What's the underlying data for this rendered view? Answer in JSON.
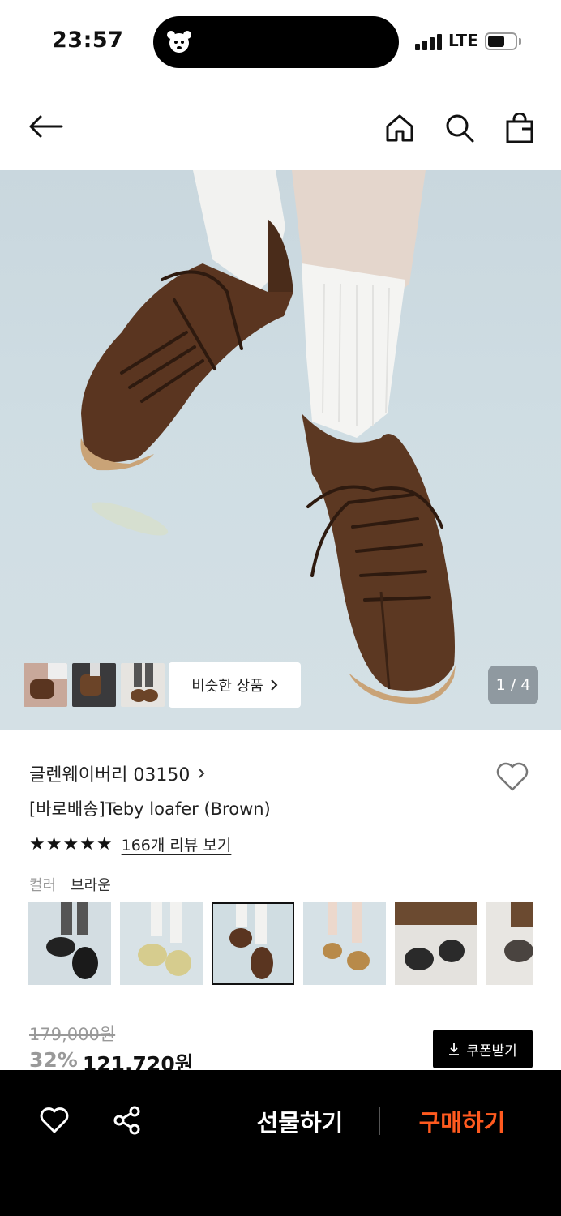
{
  "status_bar": {
    "time": "23:57",
    "network": "LTE"
  },
  "header": {
    "back_icon": "arrow-left-icon",
    "home_icon": "home-icon",
    "search_icon": "search-icon",
    "bag_icon": "shopping-bag-icon"
  },
  "gallery": {
    "similar_label": "비슷한 상품",
    "counter": "1 / 4"
  },
  "product": {
    "brand": "글렌웨이버리 03150",
    "name": "[바로배송]Teby loafer (Brown)",
    "stars": "★★★★★",
    "review_link": "166개 리뷰 보기",
    "color_label": "컬러",
    "color_value": "브라운",
    "original_price": "179,000원",
    "discount": "32%",
    "price": "121,720원",
    "coupon_label": "쿠폰받기"
  },
  "bottom_bar": {
    "gift_label": "선물하기",
    "buy_label": "구매하기"
  },
  "colors": {
    "buy": "#ff5a1f",
    "bar": "#000000"
  }
}
